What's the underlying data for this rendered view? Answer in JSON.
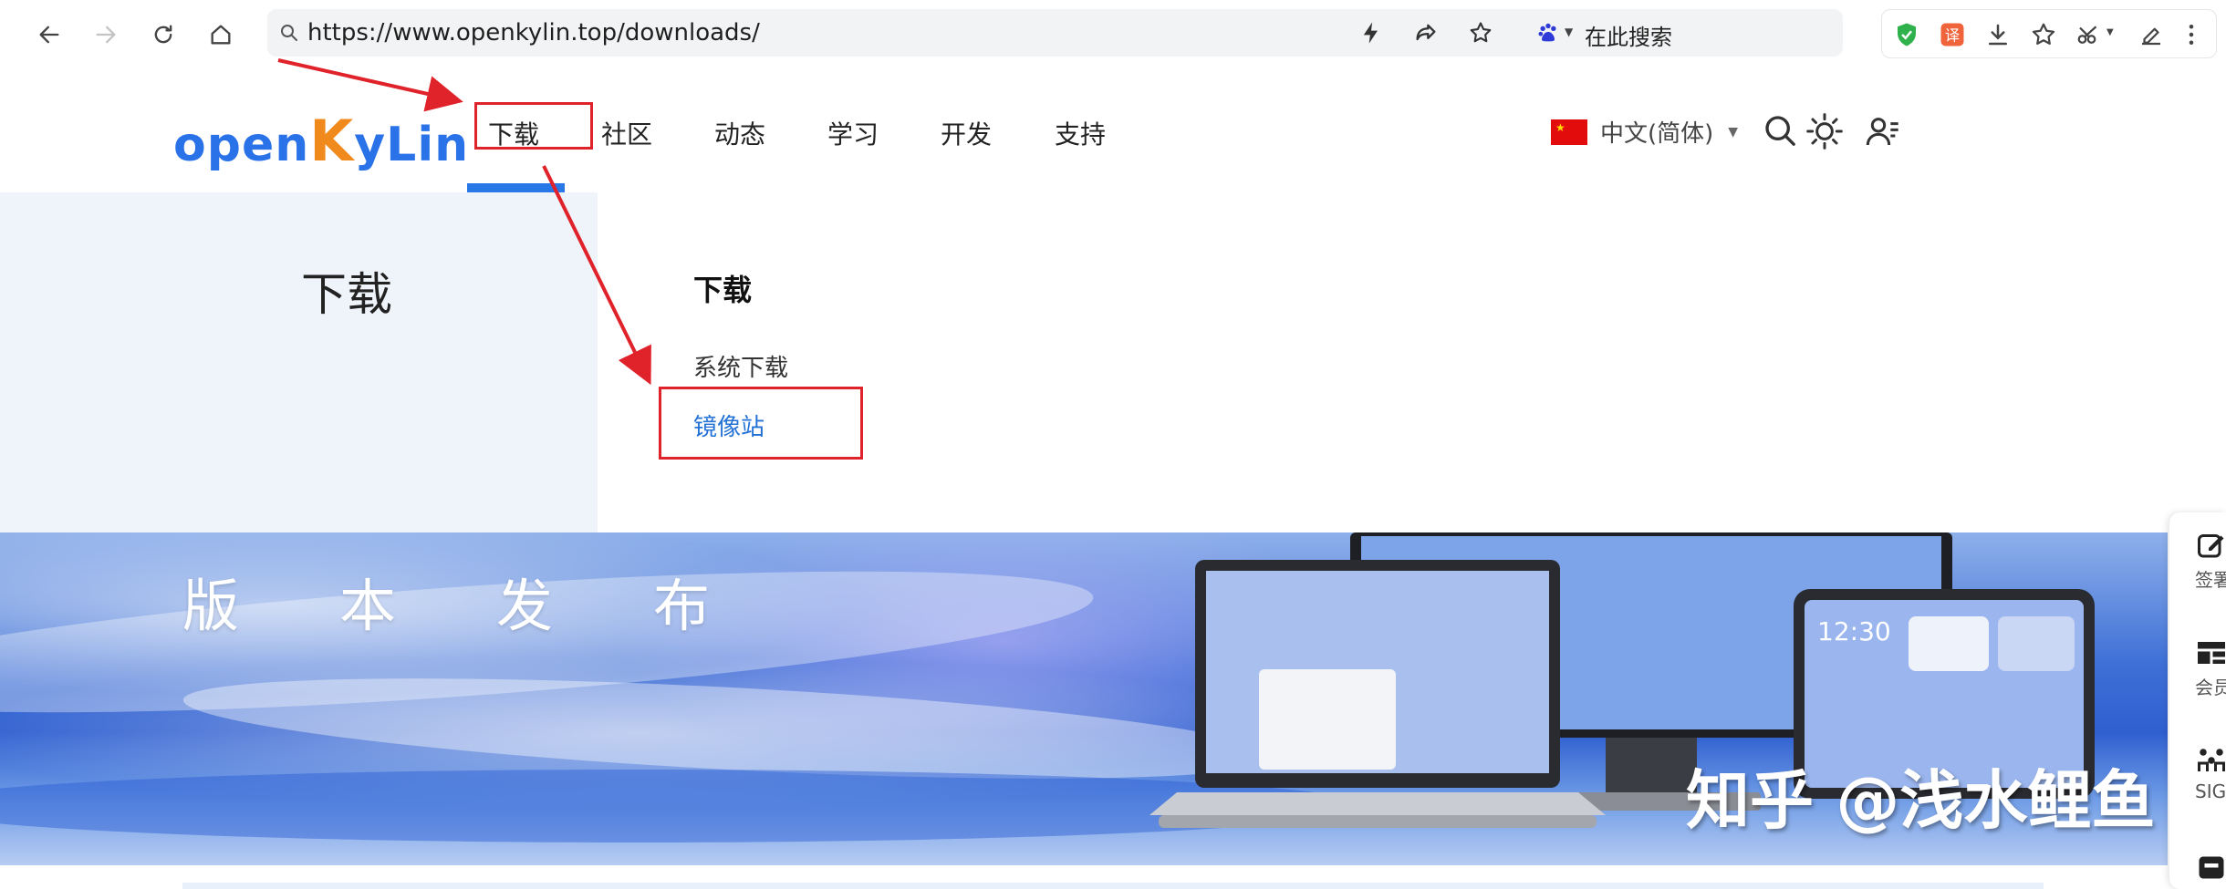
{
  "browser": {
    "url": "https://www.openkylin.top/downloads/",
    "search_engine_label": "在此搜索"
  },
  "site": {
    "logo_text_a": "open",
    "logo_text_k": "K",
    "logo_text_b": "yLin",
    "nav": [
      {
        "label": "下载",
        "active": true
      },
      {
        "label": "社区"
      },
      {
        "label": "动态"
      },
      {
        "label": "学习"
      },
      {
        "label": "开发"
      },
      {
        "label": "支持"
      }
    ],
    "language": "中文(简体)"
  },
  "dropdown": {
    "section_title": "下载",
    "heading": "下载",
    "items": [
      {
        "label": "系统下载"
      },
      {
        "label": "镜像站",
        "highlighted": true
      }
    ]
  },
  "banner": {
    "title": "版本发布",
    "watermark": "知乎 @浅水鲤鱼"
  },
  "sidebar": {
    "items": [
      {
        "label": "签署",
        "icon": "edit-icon"
      },
      {
        "label": "会员",
        "icon": "members-icon"
      },
      {
        "label": "SIG",
        "icon": "sig-icon"
      },
      {
        "label": "",
        "icon": "calendar-icon"
      }
    ]
  },
  "colors": {
    "accent": "#2978e8",
    "annotation_red": "#e0222a",
    "dropdown_left_bg": "#eff3fa"
  }
}
